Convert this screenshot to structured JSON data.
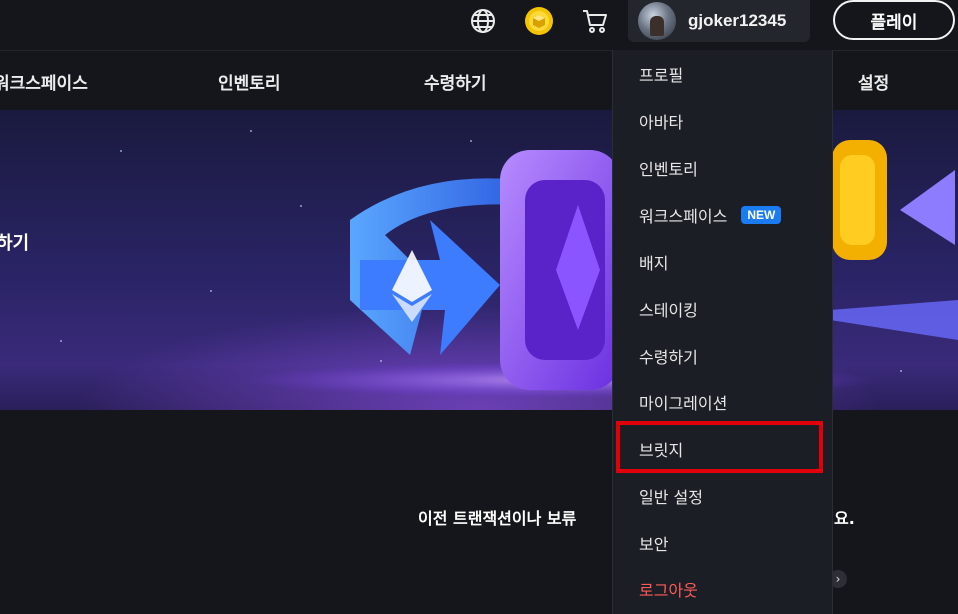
{
  "header": {
    "icons": [
      "globe-icon",
      "coin-icon",
      "cart-icon"
    ],
    "username": "gjoker12345",
    "play_label": "플레이"
  },
  "nav": {
    "items": [
      "워크스페이스",
      "인벤토리",
      "수령하기",
      "설정"
    ]
  },
  "banner": {
    "text": "하기"
  },
  "content": {
    "description": "이전 트랜잭션이나 보류",
    "description_tail": "요."
  },
  "dropdown": {
    "items": [
      {
        "label": "프로필"
      },
      {
        "label": "아바타"
      },
      {
        "label": "인벤토리"
      },
      {
        "label": "워크스페이스",
        "badge": "NEW"
      },
      {
        "label": "배지"
      },
      {
        "label": "스테이킹"
      },
      {
        "label": "수령하기"
      },
      {
        "label": "마이그레이션"
      },
      {
        "label": "브릿지"
      },
      {
        "label": "일반 설정"
      },
      {
        "label": "보안"
      },
      {
        "label": "로그아웃"
      }
    ],
    "highlighted_item": "브릿지"
  },
  "colors": {
    "background": "#14161b",
    "menu_bg": "#1b1e24",
    "new_badge": "#1a7cf0",
    "logout": "#ff5a5a",
    "highlight_box": "#e1000a"
  }
}
